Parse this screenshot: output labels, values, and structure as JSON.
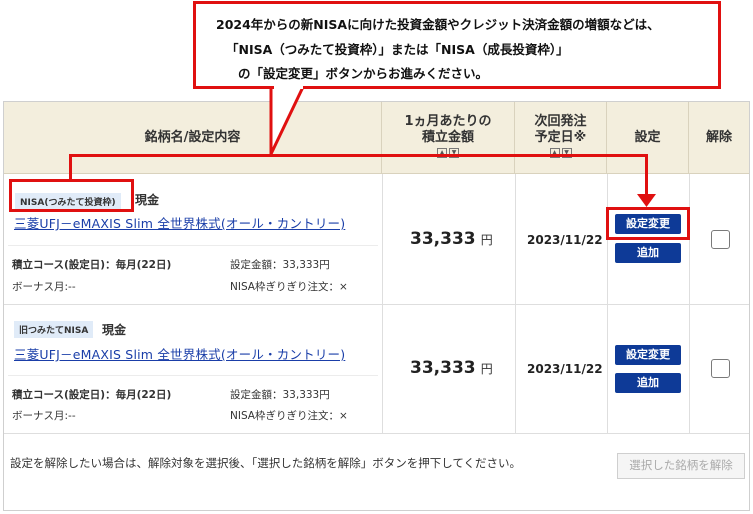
{
  "callout": {
    "line1": "2024年からの新NISAに向けた投資金額やクレジット決済金額の増額などは、",
    "line2": "「NISA（つみたて投資枠）」または「NISA（成長投資枠）」",
    "line3": "の「設定変更」ボタンからお進みください。"
  },
  "header": {
    "fund": "銘柄名/設定内容",
    "amount_line1": "1ヵ月あたりの",
    "amount_line2": "積立金額",
    "next_line1": "次回発注",
    "next_line2": "予定日※",
    "setting": "設定",
    "cancel": "解除",
    "sort_up": "▲",
    "sort_down": "▼"
  },
  "rows": [
    {
      "tag": "NISA(つみたて投資枠)",
      "kind": "現金",
      "fund_name": "三菱UFJ－eMAXIS Slim 全世界株式(オール・カントリー)",
      "course": "積立コース(設定日)：毎月(22日)",
      "setting_amount": "設定金額：33,333円",
      "bonus": "ボーナス月:--",
      "nisa_order": "NISA枠ぎりぎり注文：×",
      "amount": "33,333",
      "yen": "円",
      "next_date": "2023/11/22",
      "change_button": "設定変更",
      "add_button": "追加"
    },
    {
      "tag": "旧つみたてNISA",
      "kind": "現金",
      "fund_name": "三菱UFJ－eMAXIS Slim 全世界株式(オール・カントリー)",
      "course": "積立コース(設定日)：毎月(22日)",
      "setting_amount": "設定金額：33,333円",
      "bonus": "ボーナス月:--",
      "nisa_order": "NISA枠ぎりぎり注文：×",
      "amount": "33,333",
      "yen": "円",
      "next_date": "2023/11/22",
      "change_button": "設定変更",
      "add_button": "追加"
    }
  ],
  "footer": {
    "note": "設定を解除したい場合は、解除対象を選択後、「選択した銘柄を解除」ボタンを押下してください。",
    "remove_button": "選択した銘柄を解除"
  },
  "colors": {
    "header_bg": "#f3eedd",
    "button_blue": "#0e3a97",
    "highlight_red": "#e01010",
    "link_blue": "#1a3ea8"
  }
}
